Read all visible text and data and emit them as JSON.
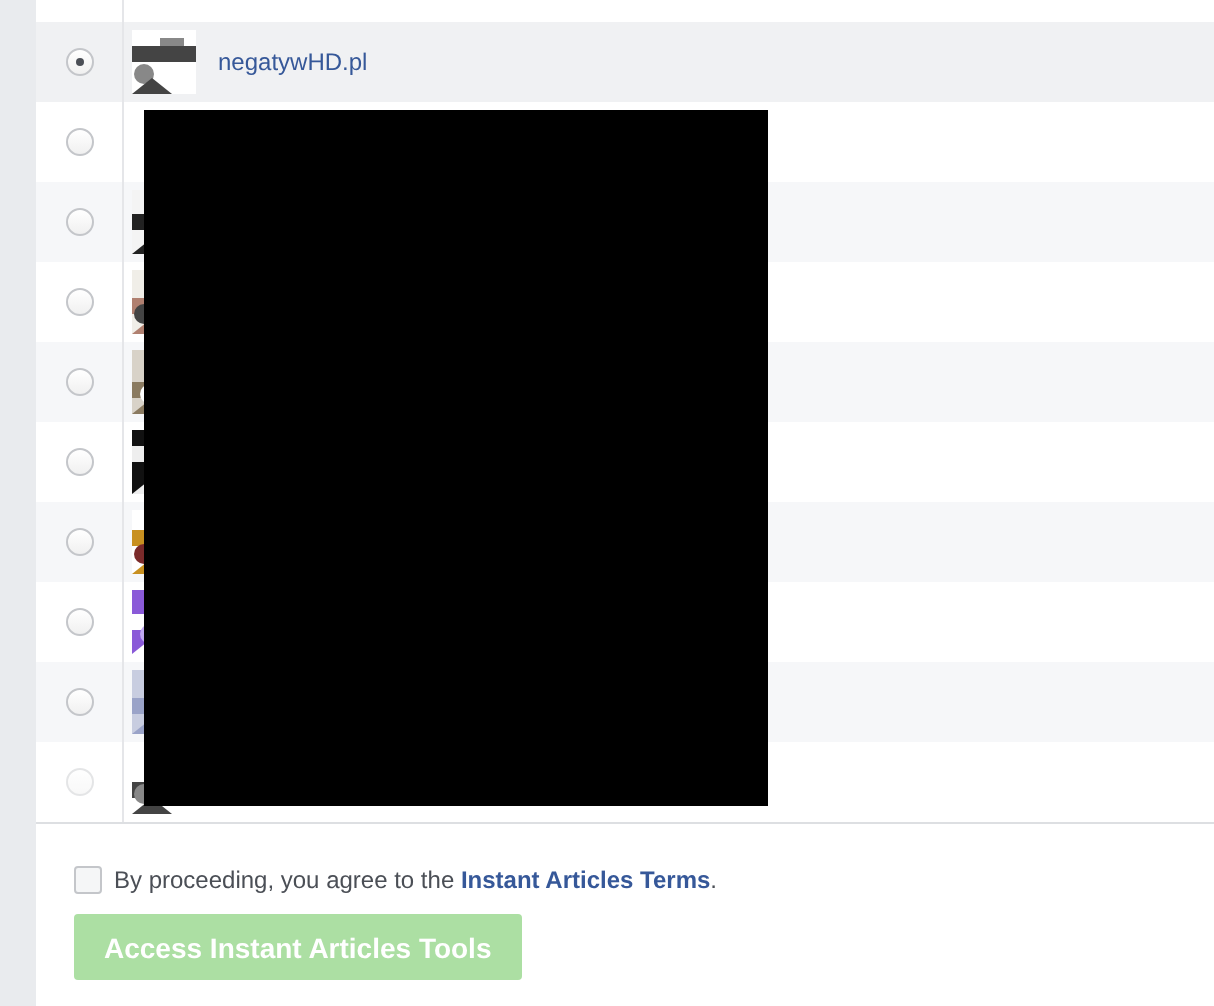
{
  "pages": [
    {
      "name": "negatywHD.pl",
      "selected": true,
      "disabled": false
    },
    {
      "selected": false,
      "disabled": false
    },
    {
      "selected": false,
      "disabled": false
    },
    {
      "selected": false,
      "disabled": false
    },
    {
      "selected": false,
      "disabled": false
    },
    {
      "selected": false,
      "disabled": false
    },
    {
      "selected": false,
      "disabled": false
    },
    {
      "selected": false,
      "disabled": false
    },
    {
      "selected": false,
      "disabled": false
    },
    {
      "selected": false,
      "disabled": true
    }
  ],
  "terms": {
    "checked": false,
    "before": "By proceeding, you agree to the ",
    "link": "Instant Articles Terms",
    "after": "."
  },
  "submit": {
    "label": "Access Instant Articles Tools",
    "disabled": true
  }
}
